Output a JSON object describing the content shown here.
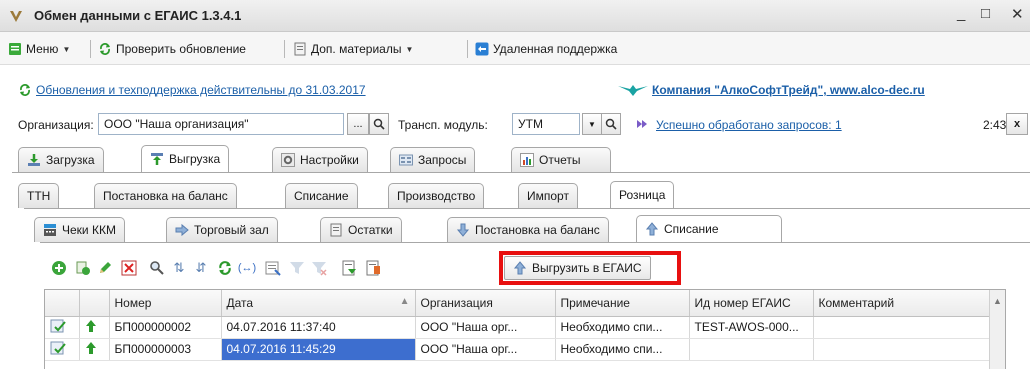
{
  "window": {
    "title": "Обмен данными с ЕГАИС 1.3.4.1",
    "minimize": "_",
    "maximize": "□",
    "close": "✕"
  },
  "menubar": {
    "menu": "Меню",
    "check_update": "Проверить обновление",
    "extra_materials": "Доп. материалы",
    "remote_support": "Удаленная поддержка"
  },
  "links": {
    "updates": "Обновления и техподдержка действительны до 31.03.2017",
    "company": "Компания \"АлкоСофтТрейд\", www.alco-dec.ru"
  },
  "org_row": {
    "org_label": "Организация:",
    "org_value": "ООО \"Наша организация\"",
    "dots": "...",
    "transport_label": "Трансп. модуль:",
    "transport_value": "УТМ",
    "processed_link": "Успешно обработано запросов: 1",
    "time": "2:43",
    "close": "x"
  },
  "main_tabs": [
    {
      "label": "Загрузка"
    },
    {
      "label": "Выгрузка"
    },
    {
      "label": "Настройки"
    },
    {
      "label": "Запросы"
    },
    {
      "label": "Отчеты"
    }
  ],
  "sub_tabs": [
    {
      "label": "ТТН"
    },
    {
      "label": "Постановка на баланс"
    },
    {
      "label": "Списание"
    },
    {
      "label": "Производство"
    },
    {
      "label": "Импорт"
    },
    {
      "label": "Розница"
    }
  ],
  "retail_tabs": [
    {
      "label": "Чеки ККМ"
    },
    {
      "label": "Торговый зал"
    },
    {
      "label": "Остатки"
    },
    {
      "label": "Постановка на баланс"
    },
    {
      "label": "Списание"
    }
  ],
  "toolbar": {
    "export_label": "Выгрузить в ЕГАИС"
  },
  "table": {
    "columns": [
      "Номер",
      "Дата",
      "Организация",
      "Примечание",
      "Ид номер ЕГАИС",
      "Комментарий"
    ],
    "rows": [
      [
        "БП000000002",
        "04.07.2016 11:37:40",
        "ООО \"Наша орг...",
        "Необходимо спи...",
        "TEST-AWOS-000...",
        ""
      ],
      [
        "БП000000003",
        "04.07.2016 11:45:29",
        "ООО \"Наша орг...",
        "Необходимо спи...",
        "",
        ""
      ]
    ]
  },
  "colors": {
    "link": "#1b5fa8",
    "highlight_box": "#e81010",
    "selection": "#3d6ecf",
    "arrow_green": "#2c9a2c"
  }
}
